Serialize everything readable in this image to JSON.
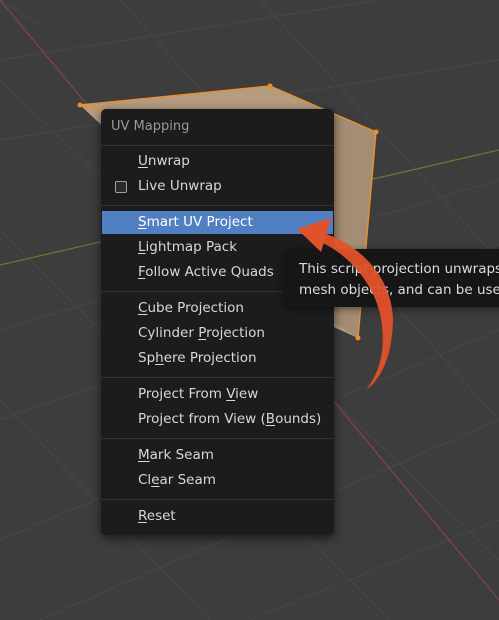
{
  "menu": {
    "title": "UV Mapping",
    "items": [
      {
        "pre": "",
        "ul": "U",
        "post": "nwrap"
      },
      {
        "pre": "",
        "ul": "",
        "post": "Live Unwrap"
      },
      {
        "pre": "",
        "ul": "S",
        "post": "mart UV Project"
      },
      {
        "pre": "",
        "ul": "L",
        "post": "ightmap Pack"
      },
      {
        "pre": "",
        "ul": "F",
        "post": "ollow Active Quads"
      },
      {
        "pre": "",
        "ul": "C",
        "post": "ube Projection"
      },
      {
        "pre": "Cylinder ",
        "ul": "P",
        "post": "rojection"
      },
      {
        "pre": "Sp",
        "ul": "h",
        "post": "ere Projection"
      },
      {
        "pre": "Project From ",
        "ul": "V",
        "post": "iew"
      },
      {
        "pre": "Project from View (",
        "ul": "B",
        "post": "ounds)"
      },
      {
        "pre": "",
        "ul": "M",
        "post": "ark Seam"
      },
      {
        "pre": "Cl",
        "ul": "e",
        "post": "ar Seam"
      },
      {
        "pre": "",
        "ul": "R",
        "post": "eset"
      }
    ],
    "highlighted_item": "Smart UV Project",
    "live_unwrap_checked": false
  },
  "tooltip": {
    "line1": "This script projection unwraps t",
    "line2": "mesh objects, and can be used"
  },
  "colors": {
    "viewport_bg": "#3d3d3d",
    "grid": "#464646",
    "x_axis": "#a3434f",
    "y_axis": "#6b8c2f",
    "mesh_face": "#b59c80",
    "mesh_edge": "#e8902c",
    "menu_bg": "#1c1c1c",
    "highlight": "#5180c2",
    "arrow": "#e2522a"
  }
}
